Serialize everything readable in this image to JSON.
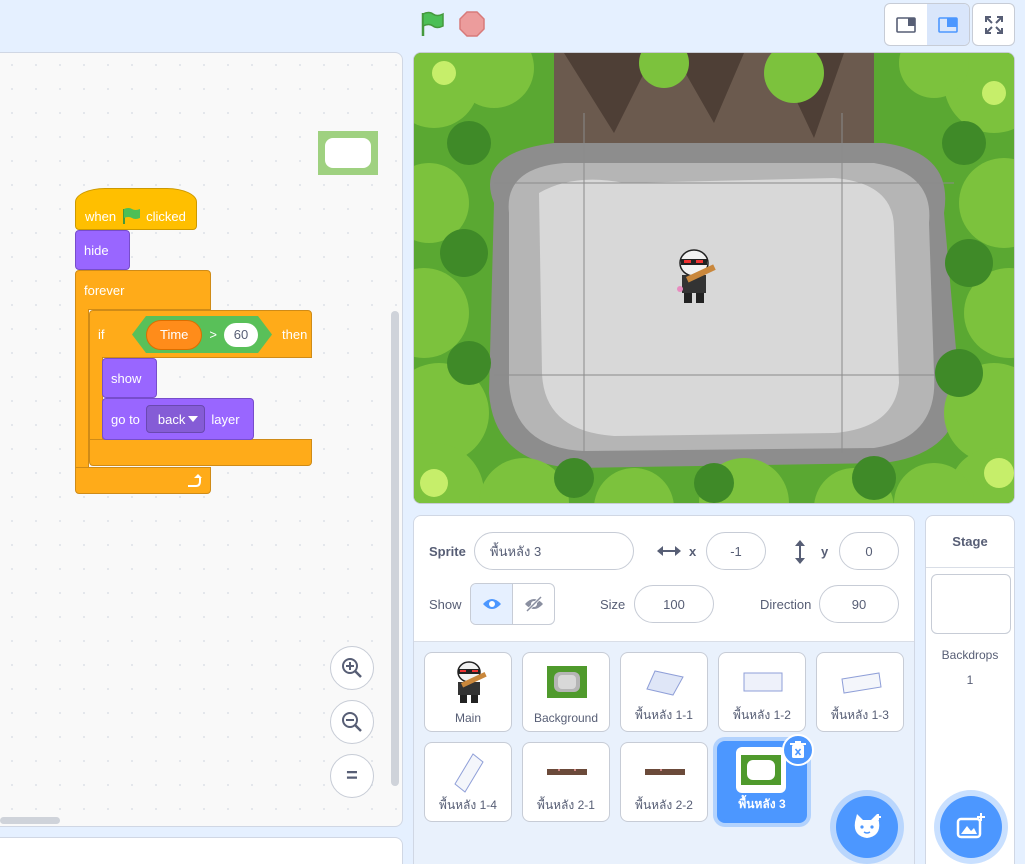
{
  "code": {
    "blocks": {
      "when_label": "when",
      "clicked_label": "clicked",
      "hide_label": "hide",
      "forever_label": "forever",
      "if_label": "if",
      "time_label": "Time",
      "gt_label": ">",
      "value_60": "60",
      "then_label": "then",
      "show_label": "show",
      "goto_label": "go to",
      "back_label": "back",
      "layer_label": "layer"
    }
  },
  "zoom": {
    "in_label": "+",
    "out_label": "−",
    "reset_label": "="
  },
  "sprite_info": {
    "sprite_label": "Sprite",
    "sprite_name": "พื้นหลัง 3",
    "x_label": "x",
    "x_value": "-1",
    "y_label": "y",
    "y_value": "0",
    "show_label": "Show",
    "size_label": "Size",
    "size_value": "100",
    "direction_label": "Direction",
    "direction_value": "90"
  },
  "sprites": [
    {
      "name": "Main"
    },
    {
      "name": "Background"
    },
    {
      "name": "พื้นหลัง 1-1"
    },
    {
      "name": "พื้นหลัง 1-2"
    },
    {
      "name": "พื้นหลัง 1-3"
    },
    {
      "name": "พื้นหลัง 1-4"
    },
    {
      "name": "พื้นหลัง 2-1"
    },
    {
      "name": "พื้นหลัง 2-2"
    },
    {
      "name": "พื้นหลัง 3"
    }
  ],
  "stage_panel": {
    "title": "Stage",
    "backdrops_label": "Backdrops",
    "backdrops_count": "1"
  },
  "colors": {
    "events": "#ffbf00",
    "looks": "#9966ff",
    "control": "#ffab19",
    "operators": "#59c059",
    "variables": "#ff8c1a",
    "accent": "#4c97ff"
  }
}
